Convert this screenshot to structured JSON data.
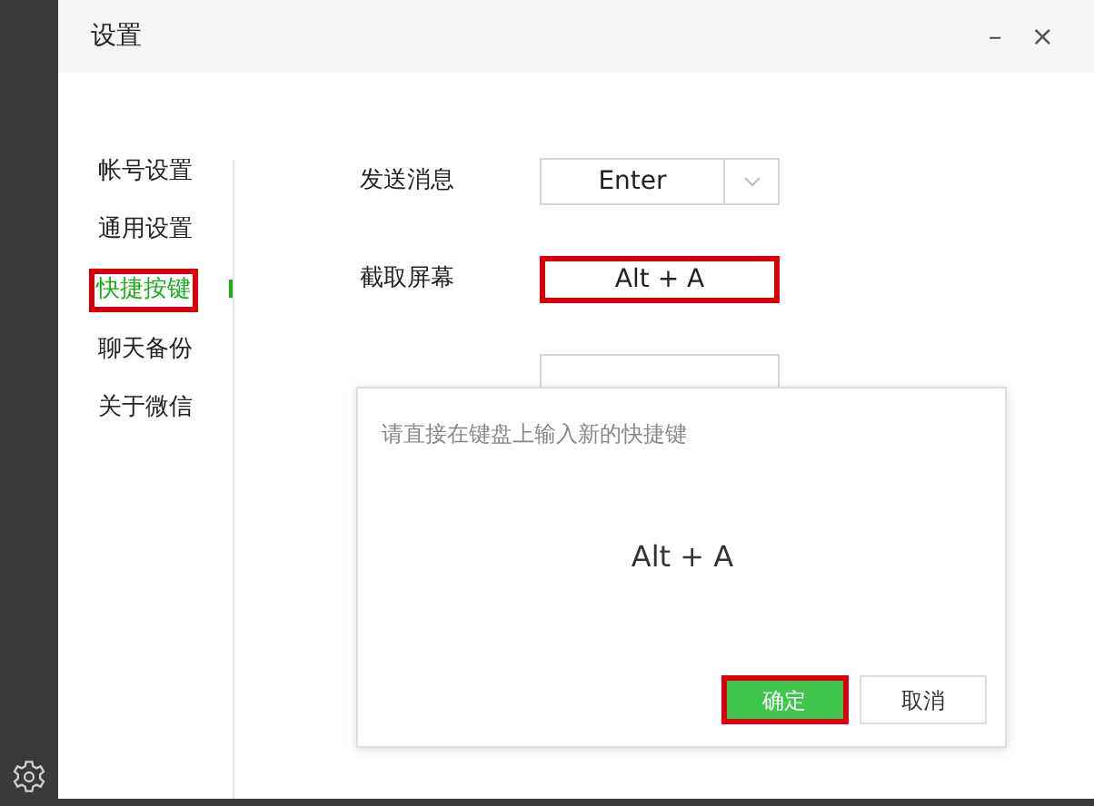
{
  "window": {
    "title": "设置",
    "controls": [
      "–",
      "×"
    ]
  },
  "sidebar": {
    "items": [
      {
        "label": "帐号设置",
        "selected": false,
        "highlighted": false
      },
      {
        "label": "通用设置",
        "selected": false,
        "highlighted": false
      },
      {
        "label": "快捷按键",
        "selected": true,
        "highlighted": true
      },
      {
        "label": "聊天备份",
        "selected": false,
        "highlighted": false
      },
      {
        "label": "关于微信",
        "selected": false,
        "highlighted": false
      }
    ]
  },
  "shortcuts": [
    {
      "label": "发送消息",
      "value": "Enter",
      "kind": "dropdown",
      "highlighted": false
    },
    {
      "label": "截取屏幕",
      "value": "Alt + A",
      "kind": "field",
      "highlighted": true
    },
    {
      "kind": "covered",
      "highlighted": false
    }
  ],
  "dialog": {
    "hint": "请直接在键盘上输入新的快捷键",
    "keys": "Alt + A",
    "buttons": [
      {
        "label": "确定",
        "kind": "primary",
        "highlighted": true
      },
      {
        "label": "取消",
        "kind": "secondary",
        "highlighted": false
      }
    ]
  }
}
